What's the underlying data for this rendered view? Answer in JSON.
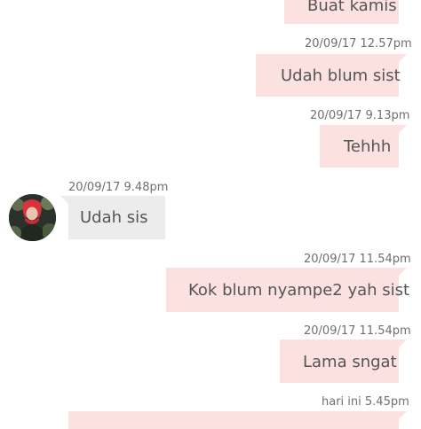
{
  "messages": [
    {
      "direction": "out",
      "time": "",
      "text": "Buat kamis"
    },
    {
      "direction": "out",
      "time": "20/09/17 12.57pm",
      "text": "Udah blum sist"
    },
    {
      "direction": "out",
      "time": "20/09/17 9.13pm",
      "text": "Tehhh"
    },
    {
      "direction": "in",
      "time": "20/09/17 9.48pm",
      "text": "Udah sis"
    },
    {
      "direction": "out",
      "time": "20/09/17 11.54pm",
      "text": "Kok blum nyampe2 yah sist"
    },
    {
      "direction": "out",
      "time": "20/09/17 11.54pm",
      "text": "Lama sngat"
    },
    {
      "direction": "in",
      "time": "hari ini 5.45pm",
      "text": ""
    }
  ],
  "colors": {
    "outgoing_bubble": "#fbe1df",
    "incoming_bubble": "#ececec",
    "text": "#555555",
    "timestamp": "#6f6f6f"
  },
  "icons": {
    "avatar": "contact-avatar-photo"
  }
}
